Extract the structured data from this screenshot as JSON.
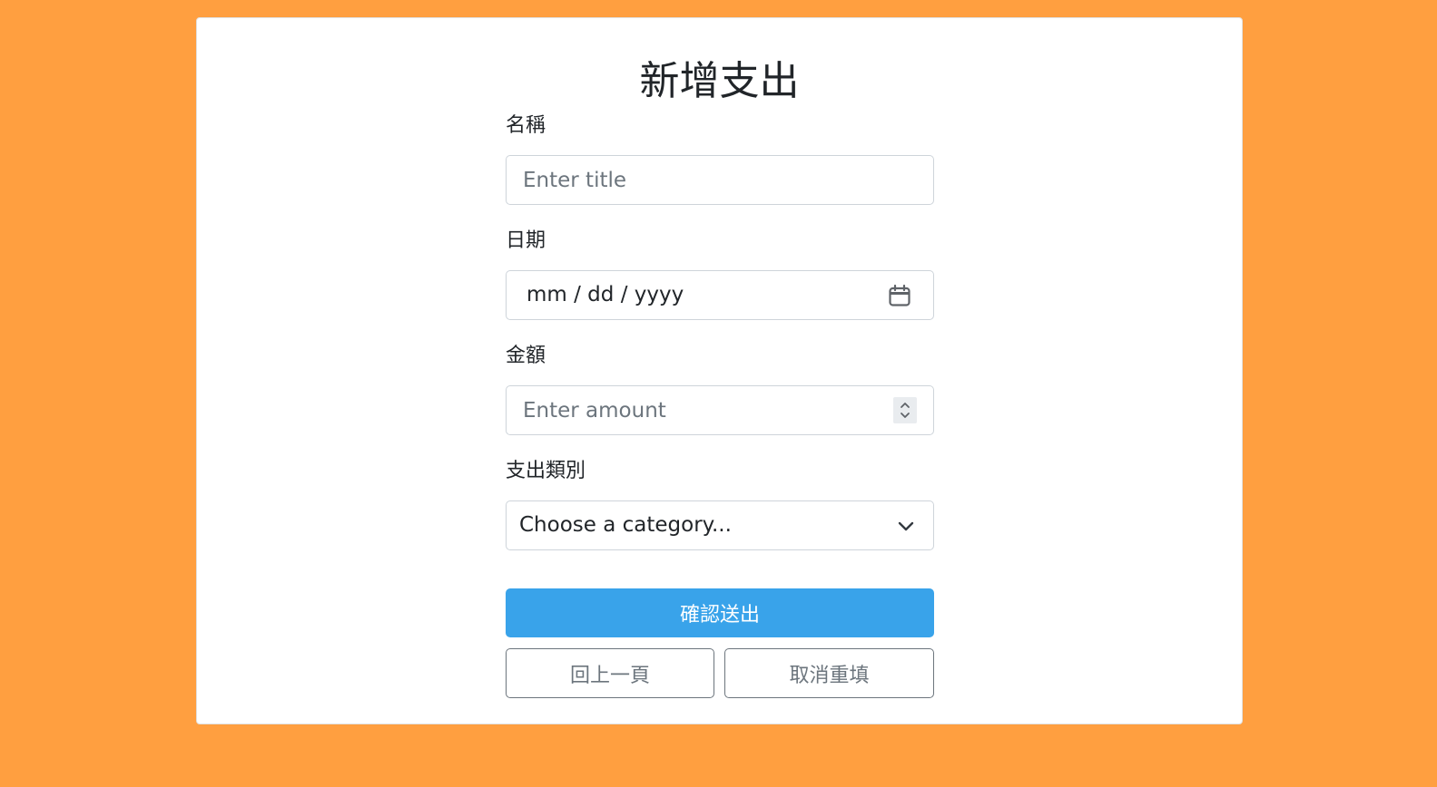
{
  "page": {
    "title": "新增支出",
    "background_color": "#ff9f40",
    "accent_color": "#39a3ea"
  },
  "form": {
    "title_field": {
      "label": "名稱",
      "placeholder": "Enter title",
      "value": ""
    },
    "date_field": {
      "label": "日期",
      "display": "mm / dd / yyyy",
      "icon": "calendar-icon"
    },
    "amount_field": {
      "label": "金額",
      "placeholder": "Enter amount",
      "value": "",
      "icon": "spinner-arrows-icon"
    },
    "category_field": {
      "label": "支出類別",
      "selected": "Choose a category...",
      "icon": "chevron-down-icon"
    },
    "submit_label": "確認送出",
    "back_label": "回上一頁",
    "reset_label": "取消重填"
  }
}
